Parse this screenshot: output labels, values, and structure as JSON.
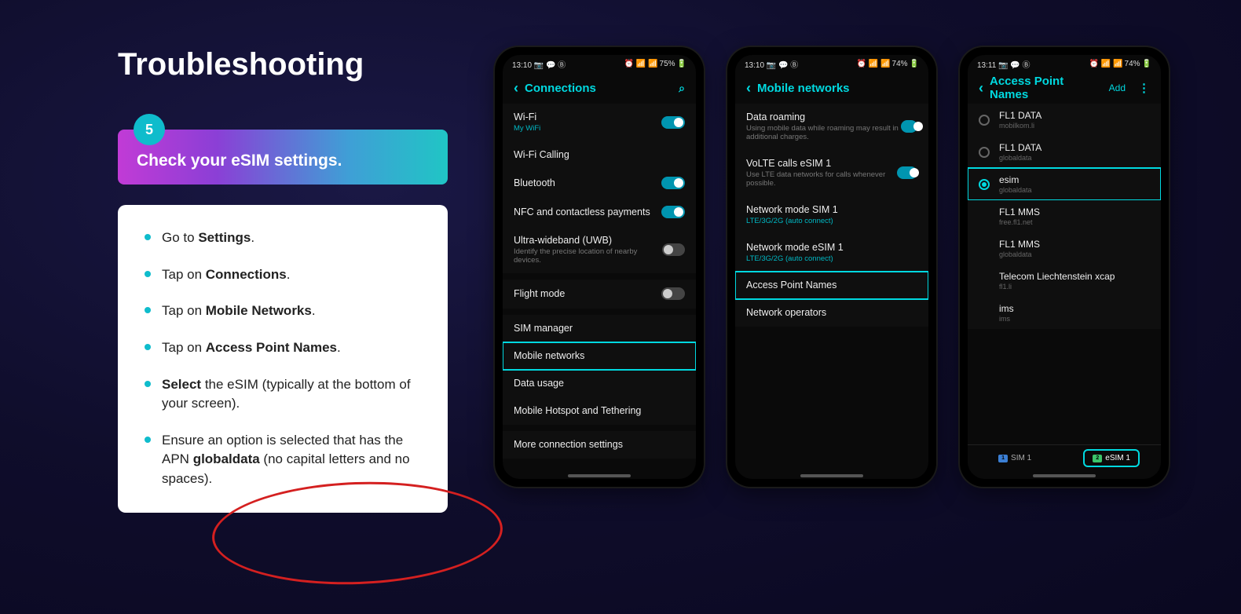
{
  "title": "Troubleshooting",
  "step": {
    "num": "5",
    "heading": "Check your eSIM settings."
  },
  "instructions": [
    {
      "pre": "Go to ",
      "bold": "Settings",
      "post": "."
    },
    {
      "pre": "Tap on ",
      "bold": "Connections",
      "post": "."
    },
    {
      "pre": "Tap on ",
      "bold": "Mobile Networks",
      "post": "."
    },
    {
      "pre": "Tap on ",
      "bold": "Access Point Names",
      "post": "."
    },
    {
      "pre": "",
      "bold": "Select",
      "post": " the eSIM (typically at the bottom of your screen)."
    },
    {
      "pre": "Ensure an option is selected that has the APN ",
      "bold": "globaldata",
      "post": " (no capital letters and no spaces)."
    }
  ],
  "phone1": {
    "time": "13:10",
    "battery": "75%",
    "header": "Connections",
    "rows": [
      {
        "label": "Wi-Fi",
        "sub": "My WiFi",
        "subAccent": true,
        "toggle": "on"
      },
      {
        "label": "Wi-Fi Calling"
      },
      {
        "label": "Bluetooth",
        "toggle": "on"
      },
      {
        "label": "NFC and contactless payments",
        "toggle": "on"
      },
      {
        "label": "Ultra-wideband (UWB)",
        "sub": "Identify the precise location of nearby devices.",
        "toggle": "off"
      },
      {
        "label": "Flight mode",
        "toggle": "off",
        "gap": true
      },
      {
        "label": "SIM manager",
        "gap": true
      },
      {
        "label": "Mobile networks",
        "highlight": true
      },
      {
        "label": "Data usage"
      },
      {
        "label": "Mobile Hotspot and Tethering"
      },
      {
        "label": "More connection settings",
        "gap": true
      }
    ]
  },
  "phone2": {
    "time": "13:10",
    "battery": "74%",
    "header": "Mobile networks",
    "rows": [
      {
        "label": "Data roaming",
        "sub": "Using mobile data while roaming may result in additional charges.",
        "toggle": "on"
      },
      {
        "label": "VoLTE calls eSIM 1",
        "sub": "Use LTE data networks for calls whenever possible.",
        "toggle": "on"
      },
      {
        "label": "Network mode SIM 1",
        "sub": "LTE/3G/2G (auto connect)",
        "subAccent": true
      },
      {
        "label": "Network mode eSIM 1",
        "sub": "LTE/3G/2G (auto connect)",
        "subAccent": true
      },
      {
        "label": "Access Point Names",
        "highlight": true
      },
      {
        "label": "Network operators"
      }
    ]
  },
  "phone3": {
    "time": "13:11",
    "battery": "74%",
    "header": "Access Point Names",
    "add": "Add",
    "apns": [
      {
        "label": "FL1 DATA",
        "sub": "mobilkom.li"
      },
      {
        "label": "FL1 DATA",
        "sub": "globaldata"
      },
      {
        "label": "esim",
        "sub": "globaldata",
        "selected": true,
        "highlight": true
      },
      {
        "label": "FL1 MMS",
        "sub": "free.fl1.net",
        "noradio": true
      },
      {
        "label": "FL1 MMS",
        "sub": "globaldata",
        "noradio": true
      },
      {
        "label": "Telecom Liechtenstein xcap",
        "sub": "fl1.li",
        "noradio": true
      },
      {
        "label": "ims",
        "sub": "ims",
        "noradio": true
      }
    ],
    "tabs": {
      "sim1": "SIM 1",
      "esim1": "eSIM 1"
    }
  }
}
